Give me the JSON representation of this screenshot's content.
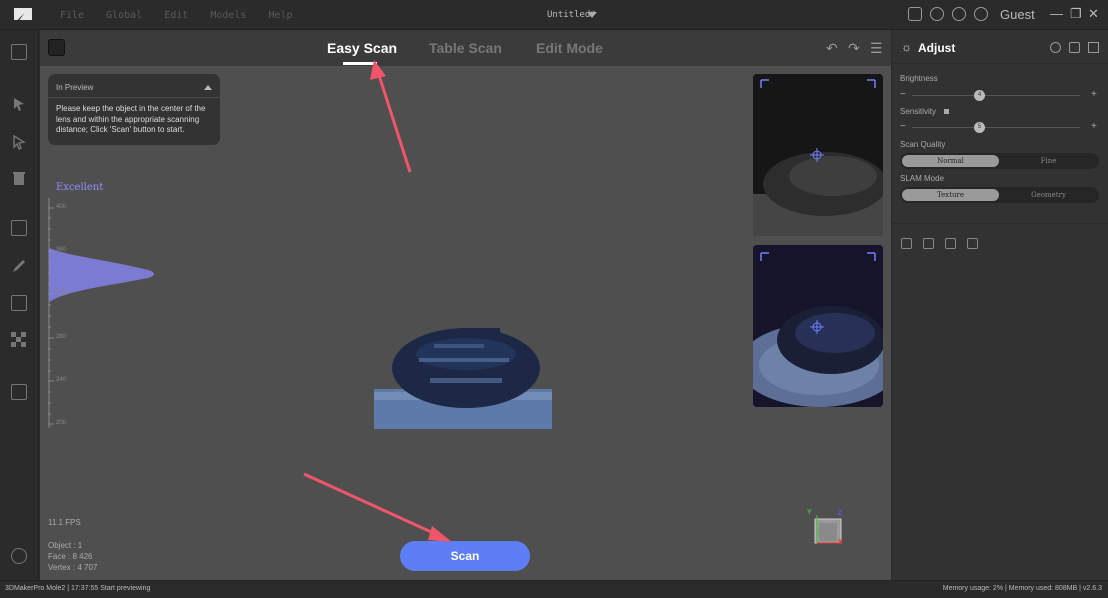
{
  "titlebar": {
    "menu": [
      "File",
      "Global",
      "Edit",
      "Models",
      "Help"
    ],
    "document_title": "Untitled*",
    "user": "Guest",
    "icons": [
      "book-icon",
      "sync-icon",
      "chat-icon",
      "bell-icon"
    ]
  },
  "tabs": [
    {
      "label": "Easy Scan",
      "active": true
    },
    {
      "label": "Table Scan",
      "active": false
    },
    {
      "label": "Edit Mode",
      "active": false
    }
  ],
  "preview": {
    "header": "In Preview",
    "message": "Please keep the object in the center of the lens and within the appropriate scanning distance; Click 'Scan' button to start."
  },
  "distance": {
    "quality": "Excellent",
    "ticks": [
      "400",
      "360",
      "320",
      "280",
      "240",
      "200"
    ]
  },
  "viewport": {
    "fps": "11.1 FPS",
    "object": "Object : 1",
    "face": "Face : 8 426",
    "vertex": "Vertex : 4 707",
    "scan_label": "Scan",
    "axis": {
      "x": "X",
      "y": "Y",
      "z": "Z"
    }
  },
  "adjust": {
    "title": "Adjust",
    "brightness_label": "Brightness",
    "brightness_value": "4",
    "sensitivity_label": "Sensitivity",
    "sensitivity_value": "5",
    "scan_quality_label": "Scan Quality",
    "scan_quality_options": [
      "Normal",
      "Fine"
    ],
    "slam_mode_label": "SLAM Mode",
    "slam_mode_options": [
      "Texture",
      "Geometry"
    ],
    "minus": "−",
    "plus": "+"
  },
  "status": {
    "left": "3DMakerPro Mole2  |  17:37:55 Start previewing",
    "right": "Memory usage: 2% | Memory used: 808MB | v2.6.3"
  },
  "colors": {
    "accent": "#5e7ef5",
    "arrow": "#f0556a",
    "histogram": "#7f7fe0"
  }
}
